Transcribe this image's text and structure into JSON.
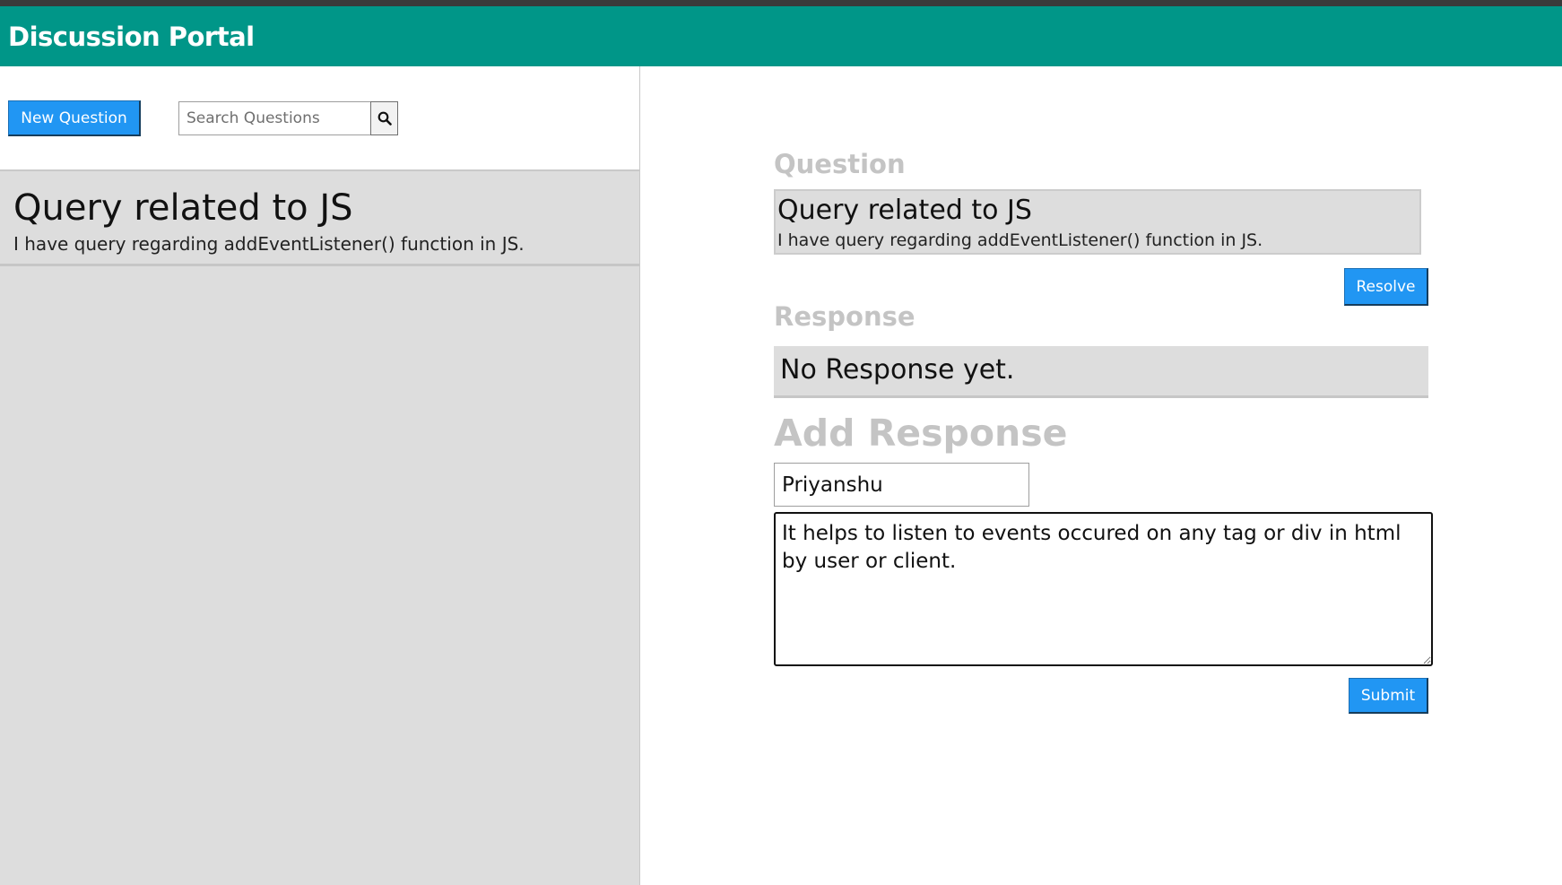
{
  "header": {
    "title": "Discussion Portal"
  },
  "sidebar": {
    "new_question_label": "New Question",
    "search": {
      "placeholder": "Search Questions",
      "value": ""
    },
    "questions": [
      {
        "title": "Query related to JS",
        "description": "I have query regarding addEventListener() function in JS."
      }
    ]
  },
  "detail": {
    "question_heading": "Question",
    "question": {
      "title": "Query related to JS",
      "description": "I have query regarding addEventListener() function in JS."
    },
    "resolve_label": "Resolve",
    "response_heading": "Response",
    "response_text": "No Response yet.",
    "add_response_heading": "Add Response",
    "name_value": "Priyanshu",
    "comment_value": "It helps to listen to events occured on any tag or div in html by user or client.",
    "submit_label": "Submit"
  },
  "icons": {
    "search": "search-icon"
  },
  "colors": {
    "header": "#009688",
    "button": "#2196f3",
    "panel": "#dddddd",
    "label": "#c4c4c4"
  }
}
